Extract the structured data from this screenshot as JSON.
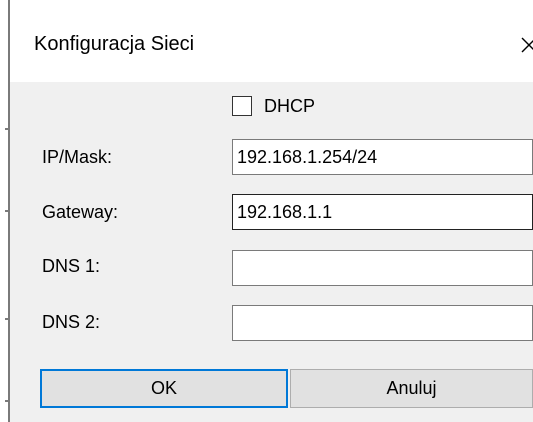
{
  "window": {
    "title": "Konfiguracja Sieci",
    "close_icon": "close-icon"
  },
  "dhcp": {
    "label": "DHCP",
    "checked": false
  },
  "fields": {
    "ip_mask": {
      "label": "IP/Mask:",
      "value": "192.168.1.254/24"
    },
    "gateway": {
      "label": "Gateway:",
      "value": "192.168.1.1"
    },
    "dns1": {
      "label": "DNS 1:",
      "value": ""
    },
    "dns2": {
      "label": "DNS 2:",
      "value": ""
    }
  },
  "buttons": {
    "ok_label": "OK",
    "cancel_label": "Anuluj"
  },
  "colors": {
    "client_bg": "#f0f0f0",
    "focus_border": "#0078d7",
    "button_bg": "#e1e1e1"
  }
}
